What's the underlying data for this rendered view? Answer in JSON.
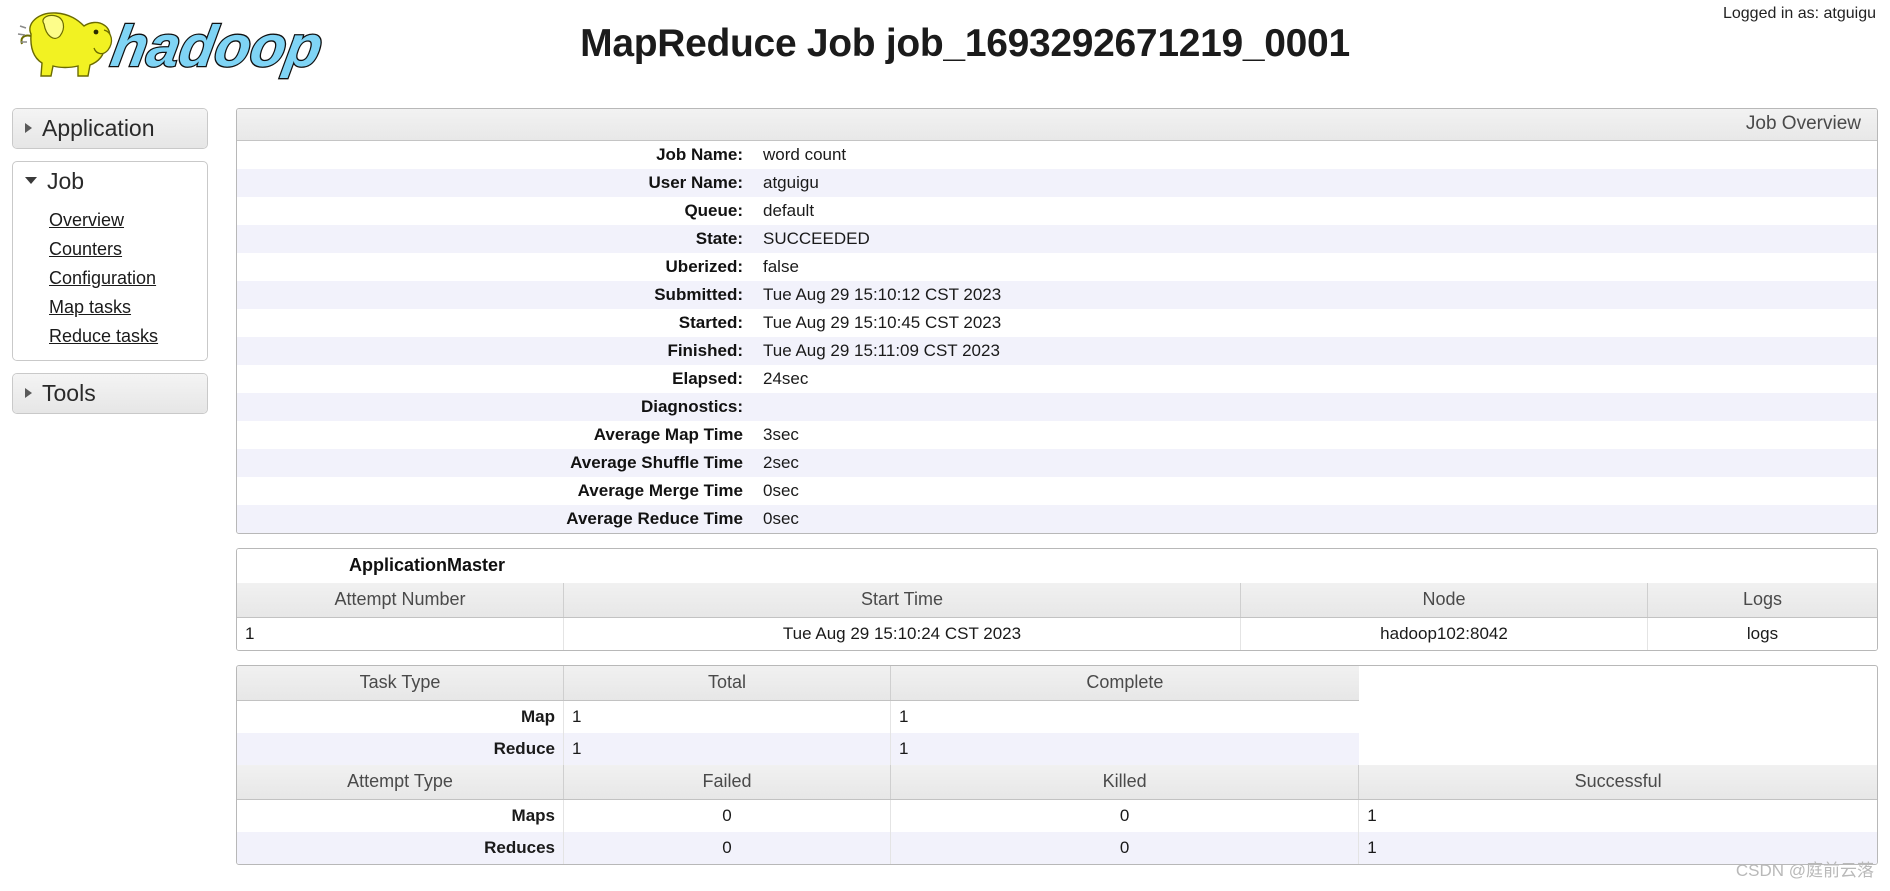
{
  "header": {
    "logo_alt": "hadoop",
    "title": "MapReduce Job job_1693292671219_0001",
    "logged_in": "Logged in as: atguigu"
  },
  "sidebar": {
    "sections": [
      {
        "label": "Application",
        "expanded": false,
        "links": []
      },
      {
        "label": "Job",
        "expanded": true,
        "links": [
          "Overview",
          "Counters",
          "Configuration",
          "Map tasks",
          "Reduce tasks"
        ]
      },
      {
        "label": "Tools",
        "expanded": false,
        "links": []
      }
    ]
  },
  "job_overview": {
    "panel_title": "Job Overview",
    "rows": [
      {
        "key": "Job Name:",
        "value": "word count"
      },
      {
        "key": "User Name:",
        "value": "atguigu"
      },
      {
        "key": "Queue:",
        "value": "default"
      },
      {
        "key": "State:",
        "value": "SUCCEEDED"
      },
      {
        "key": "Uberized:",
        "value": "false"
      },
      {
        "key": "Submitted:",
        "value": "Tue Aug 29 15:10:12 CST 2023"
      },
      {
        "key": "Started:",
        "value": "Tue Aug 29 15:10:45 CST 2023"
      },
      {
        "key": "Finished:",
        "value": "Tue Aug 29 15:11:09 CST 2023"
      },
      {
        "key": "Elapsed:",
        "value": "24sec"
      },
      {
        "key": "Diagnostics:",
        "value": ""
      },
      {
        "key": "Average Map Time",
        "value": "3sec"
      },
      {
        "key": "Average Shuffle Time",
        "value": "2sec"
      },
      {
        "key": "Average Merge Time",
        "value": "0sec"
      },
      {
        "key": "Average Reduce Time",
        "value": "0sec"
      }
    ]
  },
  "application_master": {
    "title": "ApplicationMaster",
    "columns": [
      "Attempt Number",
      "Start Time",
      "Node",
      "Logs"
    ],
    "rows": [
      {
        "attempt_number": "1",
        "start_time": "Tue Aug 29 15:10:24 CST 2023",
        "node": "hadoop102:8042",
        "logs": "logs"
      }
    ]
  },
  "task_summary": {
    "columns": [
      "Task Type",
      "Total",
      "Complete"
    ],
    "rows": [
      {
        "task_type": "Map",
        "total": "1",
        "complete": "1"
      },
      {
        "task_type": "Reduce",
        "total": "1",
        "complete": "1"
      }
    ]
  },
  "attempt_summary": {
    "columns": [
      "Attempt Type",
      "Failed",
      "Killed",
      "Successful"
    ],
    "rows": [
      {
        "attempt_type": "Maps",
        "failed": "0",
        "killed": "0",
        "successful": "1"
      },
      {
        "attempt_type": "Reduces",
        "failed": "0",
        "killed": "0",
        "successful": "1"
      }
    ]
  },
  "watermark": "CSDN @庭前云落"
}
